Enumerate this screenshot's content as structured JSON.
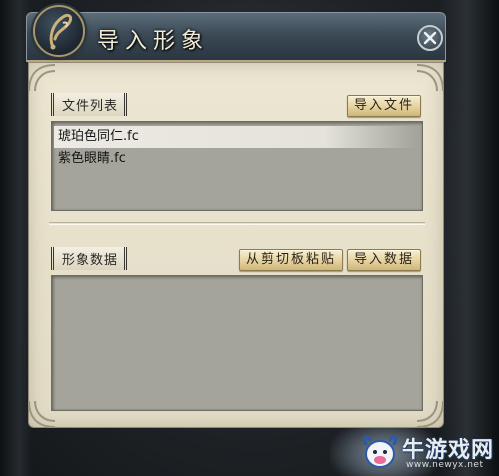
{
  "window": {
    "title": "导入形象"
  },
  "file_list": {
    "label": "文件列表",
    "import_button": "导入文件",
    "items": [
      {
        "name": "琥珀色同仁.fc",
        "selected": true
      },
      {
        "name": "紫色眼睛.fc",
        "selected": false
      }
    ]
  },
  "appearance_data": {
    "label": "形象数据",
    "paste_button": "从剪切板粘贴",
    "import_button": "导入数据"
  },
  "watermark": {
    "brand": "牛游戏网",
    "url": "www.newyx.net"
  },
  "icons": {
    "title_emblem": "quill-emblem-icon",
    "close": "close-icon"
  }
}
